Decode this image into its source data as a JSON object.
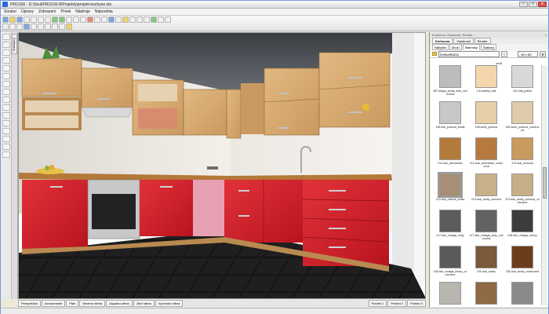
{
  "window": {
    "title": "PRO100 - D:\\Sirul\\PRO100-8\\Projekty\\projekt-kuchyne.sto",
    "controls": [
      "–",
      "□",
      "✕"
    ]
  },
  "menu": [
    "Soubor",
    "Úpravy",
    "Zobrazení",
    "Prvek",
    "Nástroje",
    "Nápověda"
  ],
  "toolbar": {
    "row1_select": "",
    "row2_select": ""
  },
  "left_side_tab": "Knihovna",
  "viewport_tabs": [
    "Perspektiva",
    "Axonometrie",
    "Plán",
    "Severní stěna",
    "Západní stěna",
    "Jižní stěna",
    "Východní stěna"
  ],
  "viewport_pages": [
    "Pohled 1",
    "Pohled 2",
    "Pohled 3"
  ],
  "right_panel": {
    "header": "Knihovna, Vlastnosti, Render ...",
    "tabs_top": [
      "Knihovna",
      "Vlastnosti",
      "Render"
    ],
    "tabs_sub": [
      "Nábytek",
      "Zboží",
      "Materiály",
      "Šablony"
    ],
    "active_sub": "Materiály",
    "folder": "Dvířka\\ŘADA",
    "zoom": "- 60 x 60",
    "top_label": "osvit",
    "swatches": [
      {
        "label": "087-skapa_svetla_lesk_vodorovná",
        "color": "#bcbcbc"
      },
      {
        "label": "1-8-vanilka_mat",
        "color": "#f4d6ac"
      },
      {
        "label": "151-bila_patina",
        "color": "#d8d8d6"
      },
      {
        "label": "155-bila_portuna_svislá",
        "color": "#c8c8c6"
      },
      {
        "label": "155-smrk_portuna",
        "color": "#e7cfa8"
      },
      {
        "label": "155-smrk_portuna_vodorovná",
        "color": "#ddcba9"
      },
      {
        "label": "212-dub_winchester",
        "color": "#b47a3c"
      },
      {
        "label": "212-dub_winchester_vodorovná",
        "color": "#b77a3e"
      },
      {
        "label": "212-dub_sonoma",
        "color": "#c89a5e"
      },
      {
        "label": "213-dub_natural_svislá",
        "color": "#a88e74"
      },
      {
        "label": "213-dub_svetly_sonoma",
        "color": "#c8b08a"
      },
      {
        "label": "213-dub_svetly_sonoma_vodorovná",
        "color": "#c7ae86"
      },
      {
        "label": "217-dub_vintage_sedy",
        "color": "#5c5c5c"
      },
      {
        "label": "217-dub_vintage_sedy_vodorovná",
        "color": "#626262"
      },
      {
        "label": "218-dub_vintage_tmavy",
        "color": "#3c3c3c"
      },
      {
        "label": "218-dub_vintage_tmavy_vodorovná",
        "color": "#5a5a5a"
      },
      {
        "label": "229-dub_smely",
        "color": "#7a5a3a"
      },
      {
        "label": "230-dub_smely_vodorovná",
        "color": "#6b3d1a"
      },
      {
        "label": "231-dub_arcos",
        "color": "#b9b6b0"
      },
      {
        "label": "232-dub_arcos_vodorovná",
        "color": "#8f6a44"
      },
      {
        "label": "233-dub_grafit",
        "color": "#8a8a88"
      }
    ]
  },
  "colors": {
    "cabinet_red": "#d71f2a",
    "cabinet_wood": "#d7a96e",
    "wall": "#f2efe9",
    "floor": "#101010",
    "accent_pink": "#e7a1b2"
  }
}
